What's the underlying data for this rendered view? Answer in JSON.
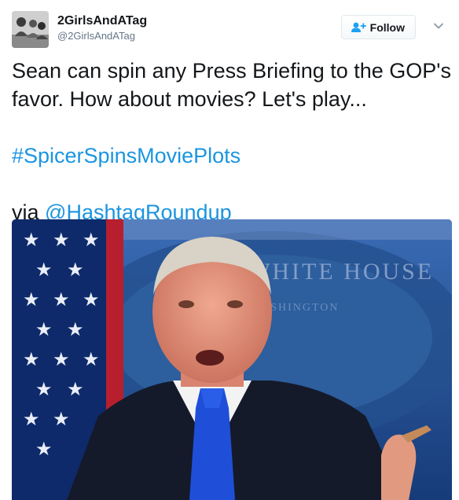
{
  "user": {
    "display_name": "2GirlsAndATag",
    "handle": "@2GirlsAndATag"
  },
  "follow_button": {
    "label": "Follow"
  },
  "tweet": {
    "line1": "Sean can spin any Press Briefing to the GOP's favor. How about movies? Let's play...",
    "hashtag": "#SpicerSpinsMoviePlots",
    "via_prefix": "via ",
    "mention": "@HashtagRoundup"
  },
  "media": {
    "backdrop_text": "THE WHITE HOUSE",
    "backdrop_text_2": "WASHINGTON"
  },
  "icons": {
    "follow": "person-plus-icon",
    "more": "chevron-down-icon"
  },
  "colors": {
    "link": "#1b95e0",
    "text": "#14171a",
    "secondary": "#657786"
  }
}
